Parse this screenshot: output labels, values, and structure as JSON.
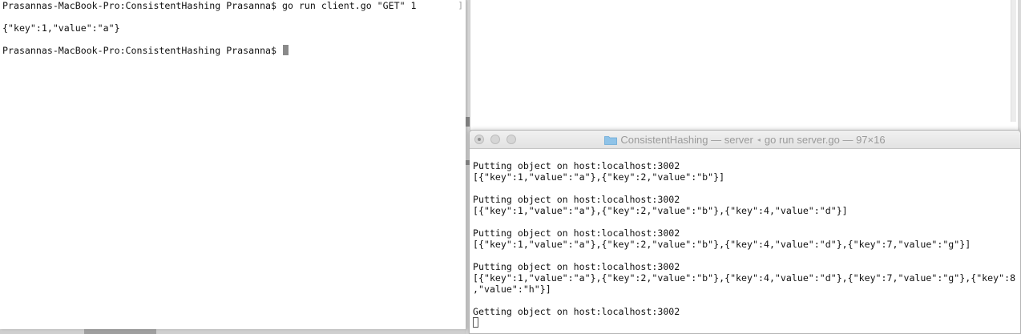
{
  "client_terminal": {
    "lines": [
      "Prasannas-MacBook-Pro:ConsistentHashing Prasanna$ go run client.go \"GET\" 1",
      "",
      "{\"key\":1,\"value\":\"a\"}",
      "",
      "Prasannas-MacBook-Pro:ConsistentHashing Prasanna$ "
    ]
  },
  "server_window": {
    "title_folder": "ConsistentHashing",
    "title_sep1": " — ",
    "title_process": "server",
    "title_arrow": "◂",
    "title_command": "go run server.go",
    "title_size": "97×16",
    "lines": [
      "Putting object on host:localhost:3002",
      "[{\"key\":1,\"value\":\"a\"},{\"key\":2,\"value\":\"b\"}]",
      "",
      "Putting object on host:localhost:3002",
      "[{\"key\":1,\"value\":\"a\"},{\"key\":2,\"value\":\"b\"},{\"key\":4,\"value\":\"d\"}]",
      "",
      "Putting object on host:localhost:3002",
      "[{\"key\":1,\"value\":\"a\"},{\"key\":2,\"value\":\"b\"},{\"key\":4,\"value\":\"d\"},{\"key\":7,\"value\":\"g\"}]",
      "",
      "Putting object on host:localhost:3002",
      "[{\"key\":1,\"value\":\"a\"},{\"key\":2,\"value\":\"b\"},{\"key\":4,\"value\":\"d\"},{\"key\":7,\"value\":\"g\"},{\"key\":8",
      ",\"value\":\"h\"}]",
      "",
      "Getting object on host:localhost:3002"
    ]
  },
  "colors": {
    "terminal_bg": "#ffffff",
    "text": "#111111",
    "titlebar_text": "#9a9a9a",
    "folder_icon": "#8fc3e8"
  },
  "icons": {
    "close": "close-button-icon",
    "minimize": "minimize-button-icon",
    "zoom": "zoom-button-icon",
    "folder": "folder-icon"
  }
}
